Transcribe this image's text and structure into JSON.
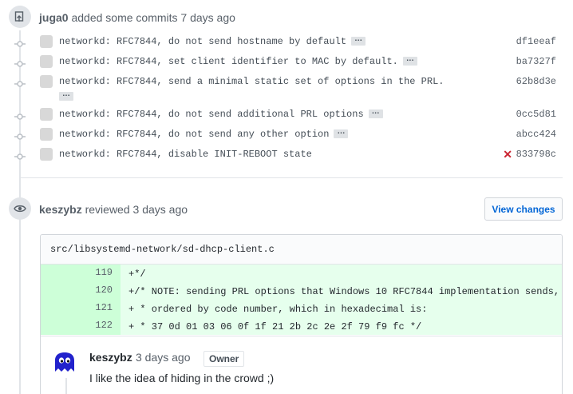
{
  "push_event": {
    "author": "juga0",
    "action": "added some commits",
    "time": "7 days ago"
  },
  "commits": [
    {
      "message": "networkd: RFC7844, do not send hostname by default",
      "has_ellipsis": true,
      "sha": "df1eeaf",
      "status": ""
    },
    {
      "message": "networkd: RFC7844, set client identifier to MAC by default.",
      "has_ellipsis": true,
      "sha": "ba7327f",
      "status": ""
    },
    {
      "message": "networkd: RFC7844, send a minimal static set of options in the PRL.",
      "has_ellipsis": true,
      "sha": "62b8d3e",
      "status": ""
    },
    {
      "message": "networkd: RFC7844, do not send additional PRL options",
      "has_ellipsis": true,
      "sha": "0cc5d81",
      "status": ""
    },
    {
      "message": "networkd: RFC7844, do not send any other option",
      "has_ellipsis": true,
      "sha": "abcc424",
      "status": ""
    },
    {
      "message": "networkd: RFC7844, disable INIT-REBOOT state",
      "has_ellipsis": false,
      "sha": "833798c",
      "status": "failure"
    }
  ],
  "ellipsis_label": "…",
  "fail_glyph": "✕",
  "review_event": {
    "author": "keszybz",
    "action": "reviewed",
    "time": "3 days ago",
    "view_changes_label": "View changes"
  },
  "diff": {
    "file_path": "src/libsystemd-network/sd-dhcp-client.c",
    "lines": [
      {
        "number": "119",
        "code": "+*/"
      },
      {
        "number": "120",
        "code": "+/* NOTE: sending PRL options that Windows 10 RFC7844 implementation sends,"
      },
      {
        "number": "121",
        "code": "+ * ordered by code number, which in hexadecimal is:"
      },
      {
        "number": "122",
        "code": "+ * 37 0d 01 03 06 0f 1f 21 2b 2c 2e 2f 79 f9 fc */"
      }
    ]
  },
  "comment": {
    "author": "keszybz",
    "time": "3 days ago",
    "role_badge": "Owner",
    "body": "I like the idea of hiding in the crowd ;)"
  },
  "colors": {
    "link": "#0366d6",
    "failure": "#cb2431",
    "addition_bg": "#e6ffed",
    "addition_num_bg": "#cdffd8"
  },
  "icons": {
    "push": "repo-push-icon",
    "commit": "git-commit-icon",
    "review": "eye-icon",
    "failure": "x-icon"
  }
}
